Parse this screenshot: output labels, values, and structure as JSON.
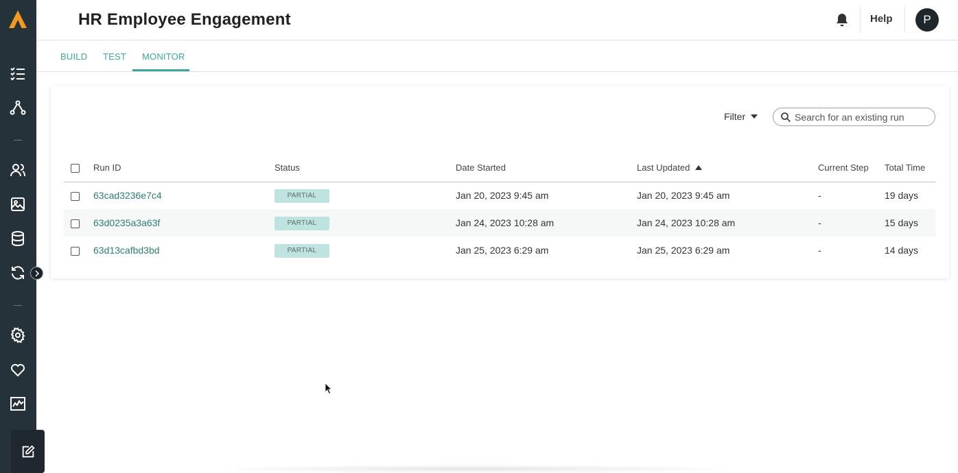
{
  "app": {
    "title": "HR Employee Engagement"
  },
  "header": {
    "help_label": "Help",
    "avatar_initial": "P"
  },
  "tabs": [
    {
      "label": "BUILD"
    },
    {
      "label": "TEST"
    },
    {
      "label": "MONITOR",
      "active": true
    }
  ],
  "toolbar": {
    "filter_label": "Filter",
    "search_placeholder": "Search for an existing run"
  },
  "table": {
    "columns": [
      "Run ID",
      "Status",
      "Date Started",
      "Last Updated",
      "Current Step",
      "Total Time"
    ],
    "sort": {
      "column": "Last Updated",
      "direction": "ascending"
    },
    "rows": [
      {
        "run_id": "63cad3236e7c4",
        "status": "PARTIAL",
        "date_started": "Jan 20, 2023 9:45 am",
        "last_updated": "Jan 20, 2023 9:45 am",
        "current_step": "-",
        "total_time": "19 days"
      },
      {
        "run_id": "63d0235a3a63f",
        "status": "PARTIAL",
        "date_started": "Jan 24, 2023 10:28 am",
        "last_updated": "Jan 24, 2023 10:28 am",
        "current_step": "-",
        "total_time": "15 days"
      },
      {
        "run_id": "63d13cafbd3bd",
        "status": "PARTIAL",
        "date_started": "Jan 25, 2023 6:29 am",
        "last_updated": "Jan 25, 2023 6:29 am",
        "current_step": "-",
        "total_time": "14 days"
      }
    ]
  },
  "sidebar": {
    "icons": [
      "task-list-icon",
      "workflow-icon",
      "users-icon",
      "image-icon",
      "database-icon",
      "sync-icon",
      "settings-icon",
      "heart-icon",
      "chart-icon",
      "edit-icon"
    ]
  },
  "colors": {
    "accent": "#3aa79a",
    "sidebar": "#26323a",
    "logo": "#f29a1f",
    "badge": "#bfe3df"
  }
}
